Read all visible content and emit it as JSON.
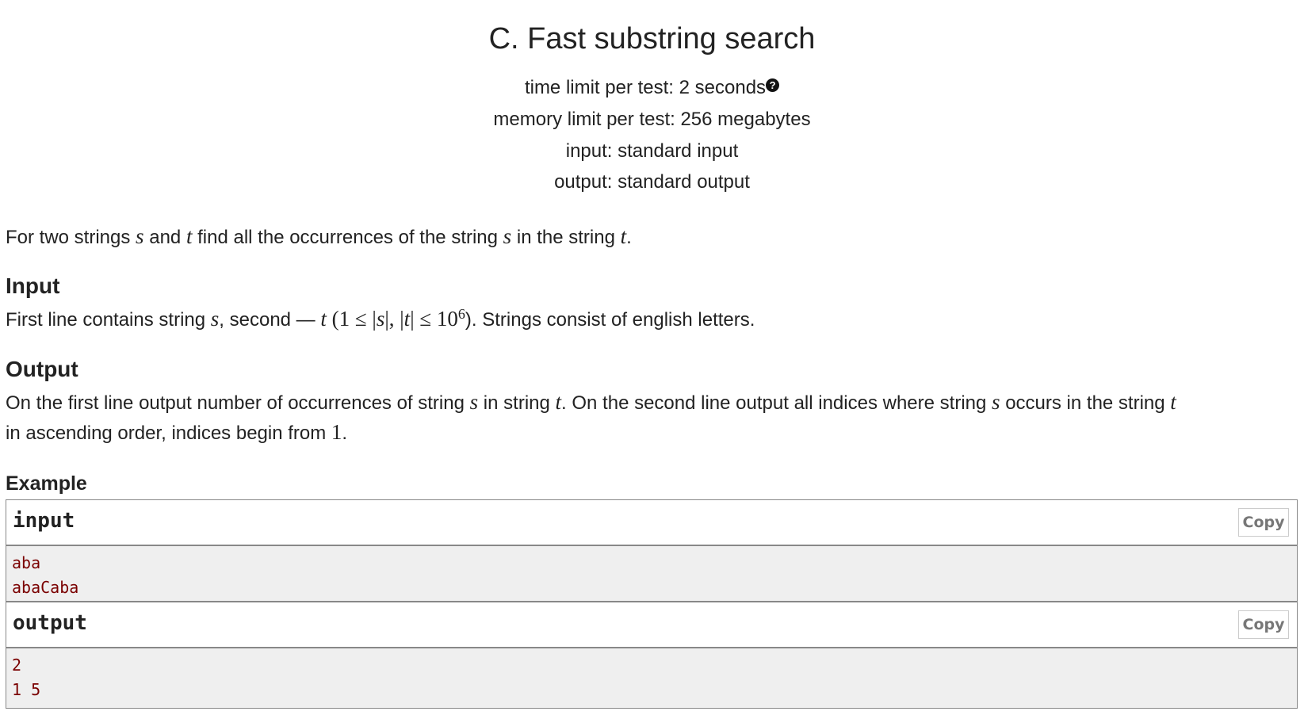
{
  "problem": {
    "title": "C. Fast substring search",
    "time_limit": "time limit per test: 2 seconds",
    "memory_limit": "memory limit per test: 256 megabytes",
    "input_file": "input: standard input",
    "output_file": "output: standard output"
  },
  "statement": {
    "p1": [
      "For two strings ",
      "s",
      " and ",
      "t",
      " find all the occurrences of the string ",
      "s",
      " in the string ",
      "t",
      "."
    ]
  },
  "input_section": {
    "heading": "Input",
    "text": [
      "First line contains string ",
      "s",
      ", second — ",
      "t",
      " (",
      "1 ≤ |",
      "s",
      "|, |",
      "t",
      "| ≤ 10",
      "6",
      "). Strings consist of english letters."
    ]
  },
  "output_section": {
    "heading": "Output",
    "line1": [
      "On the first line output number of occurrences of string ",
      "s",
      " in string ",
      "t",
      ". On the second line output all indices where string ",
      "s",
      " occurs in the string ",
      "t"
    ],
    "line2": [
      "in ascending order, indices begin from ",
      "1",
      "."
    ]
  },
  "example": {
    "heading": "Example",
    "copy_label": "Copy",
    "input_title": "input",
    "input_lines": [
      "aba",
      "abaCaba"
    ],
    "output_title": "output",
    "output_lines": [
      "2",
      "1 5"
    ]
  }
}
